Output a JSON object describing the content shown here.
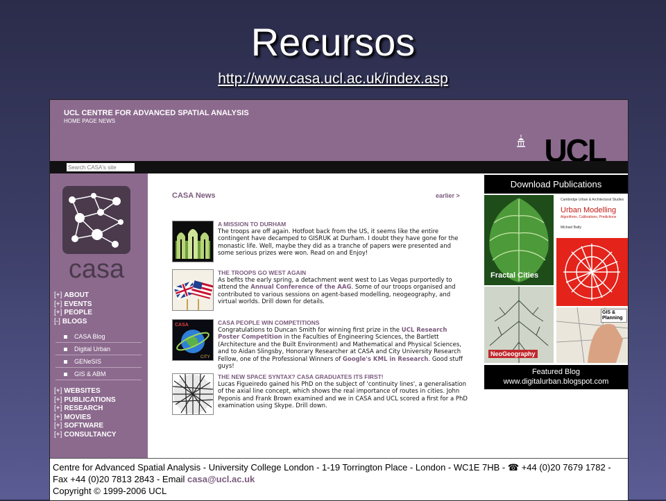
{
  "slide": {
    "title": "Recursos",
    "link": "http://www.casa.ucl.ac.uk/index.asp"
  },
  "site": {
    "header_title": "UCL CENTRE FOR ADVANCED SPATIAL ANALYSIS",
    "header_sub": "HOME PAGE NEWS",
    "logo": "UCL",
    "search_placeholder": "Search CASA's site",
    "casa_logo_text": "casa"
  },
  "nav_top": [
    {
      "bracket": "[+]",
      "label": "ABOUT"
    },
    {
      "bracket": "[+]",
      "label": "EVENTS"
    },
    {
      "bracket": "[+]",
      "label": "PEOPLE"
    },
    {
      "bracket": "[-]",
      "label": "BLOGS"
    }
  ],
  "subnav": [
    "CASA Blog",
    "Digital Urban",
    "GENeSIS",
    "GIS & ABM"
  ],
  "nav_bottom": [
    {
      "bracket": "[+]",
      "label": "WEBSITES"
    },
    {
      "bracket": "[+]",
      "label": "PUBLICATIONS"
    },
    {
      "bracket": "[+]",
      "label": "RESEARCH"
    },
    {
      "bracket": "[+]",
      "label": "MOVIES"
    },
    {
      "bracket": "[+]",
      "label": "SOFTWARE"
    },
    {
      "bracket": "[+]",
      "label": "CONSULTANCY"
    }
  ],
  "news": {
    "heading": "CASA News",
    "earlier": "earlier >",
    "items": [
      {
        "title": "A MISSION TO DURHAM",
        "body": "The troops are off again. Hotfoot back from the US, it seems like the entire contingent have decamped to GISRUK at Durham. I doubt they have gone for the monastic life. Well, maybe they did as a tranche of papers were presented and some serious prizes were won. Read on and Enjoy!"
      },
      {
        "title": "THE TROOPS GO WEST AGAIN",
        "body_a": "As befits the early spring, a detachment went west to Las Vegas purportedly to attend the ",
        "body_link": "Annual Conference of the AAG",
        "body_b": ". Some of our troops organised and contributed to various sessions on agent-based modelling, neogeography, and virtual worlds. Drill down for details."
      },
      {
        "title": "CASA PEOPLE WIN COMPETITIONS",
        "body_a": "Congratulations to Duncan Smith for winning first prize in the ",
        "body_link": "UCL Research Poster Competition",
        "body_b": " in the Faculties of Engineering Sciences, the Bartlett (Architecture and the Built Environment) and Mathematical and Physical Sciences, and to Aidan Slingsby, Honorary Researcher at CASA and City University Research Fellow, one of the Professional Winners of ",
        "body_link2": "Google's KML in Research",
        "body_c": ". Good stuff guys!"
      },
      {
        "title": "THE NEW SPACE SYNTAX? CASA GRADUATES ITS FIRST!",
        "body": "Lucas Figueiredo gained his PhD on the subject of 'continuity lines', a generalisation of the axial line concept, which shows the real importance of routes in cities. John Peponis and Frank Brown examined and we in CASA and UCL scored a first for a PhD examination using Skype. Drill down."
      }
    ]
  },
  "right": {
    "download": "Download Publications",
    "fractal": "Fractal Cities",
    "urban_top": "Cambridge Urban & Architectural Studies",
    "urban_title": "Urban Modelling",
    "urban_sub": "Algorithms, Calibrations, Predictions",
    "urban_author": "Michael Batty",
    "neo": "NeoGeography",
    "gis": "GIS & Planning",
    "featured_1": "Featured Blog",
    "featured_2": "www.digitalurban.blogspot.com"
  },
  "footer": {
    "line": "Centre for Advanced Spatial Analysis - University College London - 1-19 Torrington Place - London - WC1E 7HB - ☎ +44 (0)20 7679 1782 - Fax +44 (0)20 7813 2843 - Email ",
    "email": "casa@ucl.ac.uk",
    "copyright": "Copyright © 1999-2006 UCL"
  },
  "colors": {
    "purple": "#8c6a8e",
    "link_purple": "#7b5b7e"
  }
}
